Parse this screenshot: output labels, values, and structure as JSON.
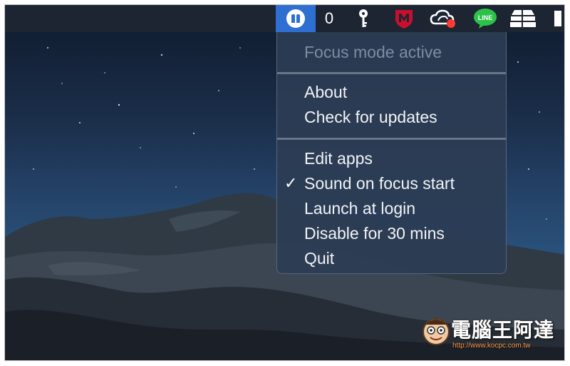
{
  "menubar": {
    "counter": "0",
    "icons": {
      "active_app": "focus-app-icon",
      "key": "key-icon",
      "mcafee": "mcafee-shield-icon",
      "cloud": "cloud-sync-icon",
      "line": "line-messenger-icon",
      "stack": "stack-icon",
      "edge": "partial-icon"
    },
    "line_label": "LINE"
  },
  "menu": {
    "status": "Focus mode active",
    "items_group1": [
      "About",
      "Check for updates"
    ],
    "items_group2": [
      "Edit apps",
      "Sound on focus start",
      "Launch at login",
      "Disable for 30 mins",
      "Quit"
    ],
    "checkmark": "✓",
    "checked_item": "Sound on focus start"
  },
  "watermark": {
    "title": "電腦王阿達",
    "url": "http://www.kocpc.com.tw"
  },
  "colors": {
    "menubar_bg": "#1d2533",
    "active_icon_bg": "#2f6fd2",
    "menu_bg": "#2c3c54",
    "line_green": "#2cc24a",
    "mcafee_red": "#c8102e",
    "notification_red": "#ff3b30"
  }
}
